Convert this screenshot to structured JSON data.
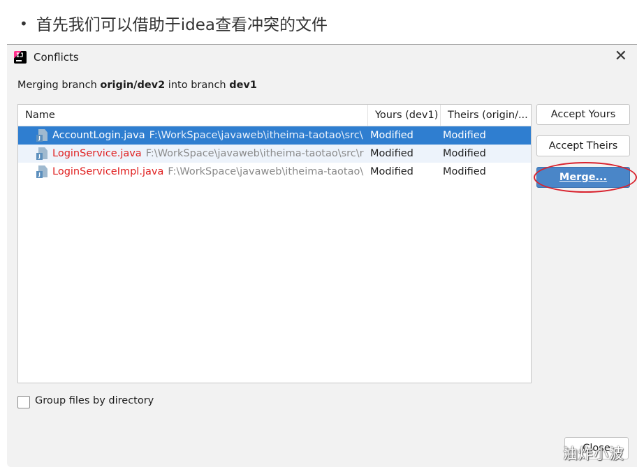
{
  "slide": {
    "bullet": "首先我们可以借助于idea查看冲突的文件"
  },
  "dialog": {
    "title": "Conflicts",
    "close_glyph": "✕",
    "merge_info": {
      "prefix": "Merging branch ",
      "source_branch": "origin/dev2",
      "middle": " into branch ",
      "target_branch": "dev1"
    },
    "table": {
      "columns": {
        "name": "Name",
        "yours": "Yours (dev1)",
        "theirs": "Theirs (origin/..."
      },
      "rows": [
        {
          "file": "AccountLogin.java",
          "path": "F:\\WorkSpace\\javaweb\\itheima-taotao\\src\\",
          "yours": "Modified",
          "theirs": "Modified",
          "selected": true
        },
        {
          "file": "LoginService.java",
          "path": "F:\\WorkSpace\\javaweb\\itheima-taotao\\src\\r",
          "yours": "Modified",
          "theirs": "Modified",
          "selected": false
        },
        {
          "file": "LoginServiceImpl.java",
          "path": "F:\\WorkSpace\\javaweb\\itheima-taotao\\",
          "yours": "Modified",
          "theirs": "Modified",
          "selected": false
        }
      ]
    },
    "buttons": {
      "accept_yours": "Accept Yours",
      "accept_theirs": "Accept Theirs",
      "merge": "Merge...",
      "close": "Close"
    },
    "group_by_directory": {
      "label": "Group files by directory",
      "checked": false
    }
  },
  "watermark": "油炸小波",
  "colors": {
    "selection": "#2f7ed0",
    "conflict_file": "#e02020",
    "highlight_ellipse": "#d9232e"
  }
}
